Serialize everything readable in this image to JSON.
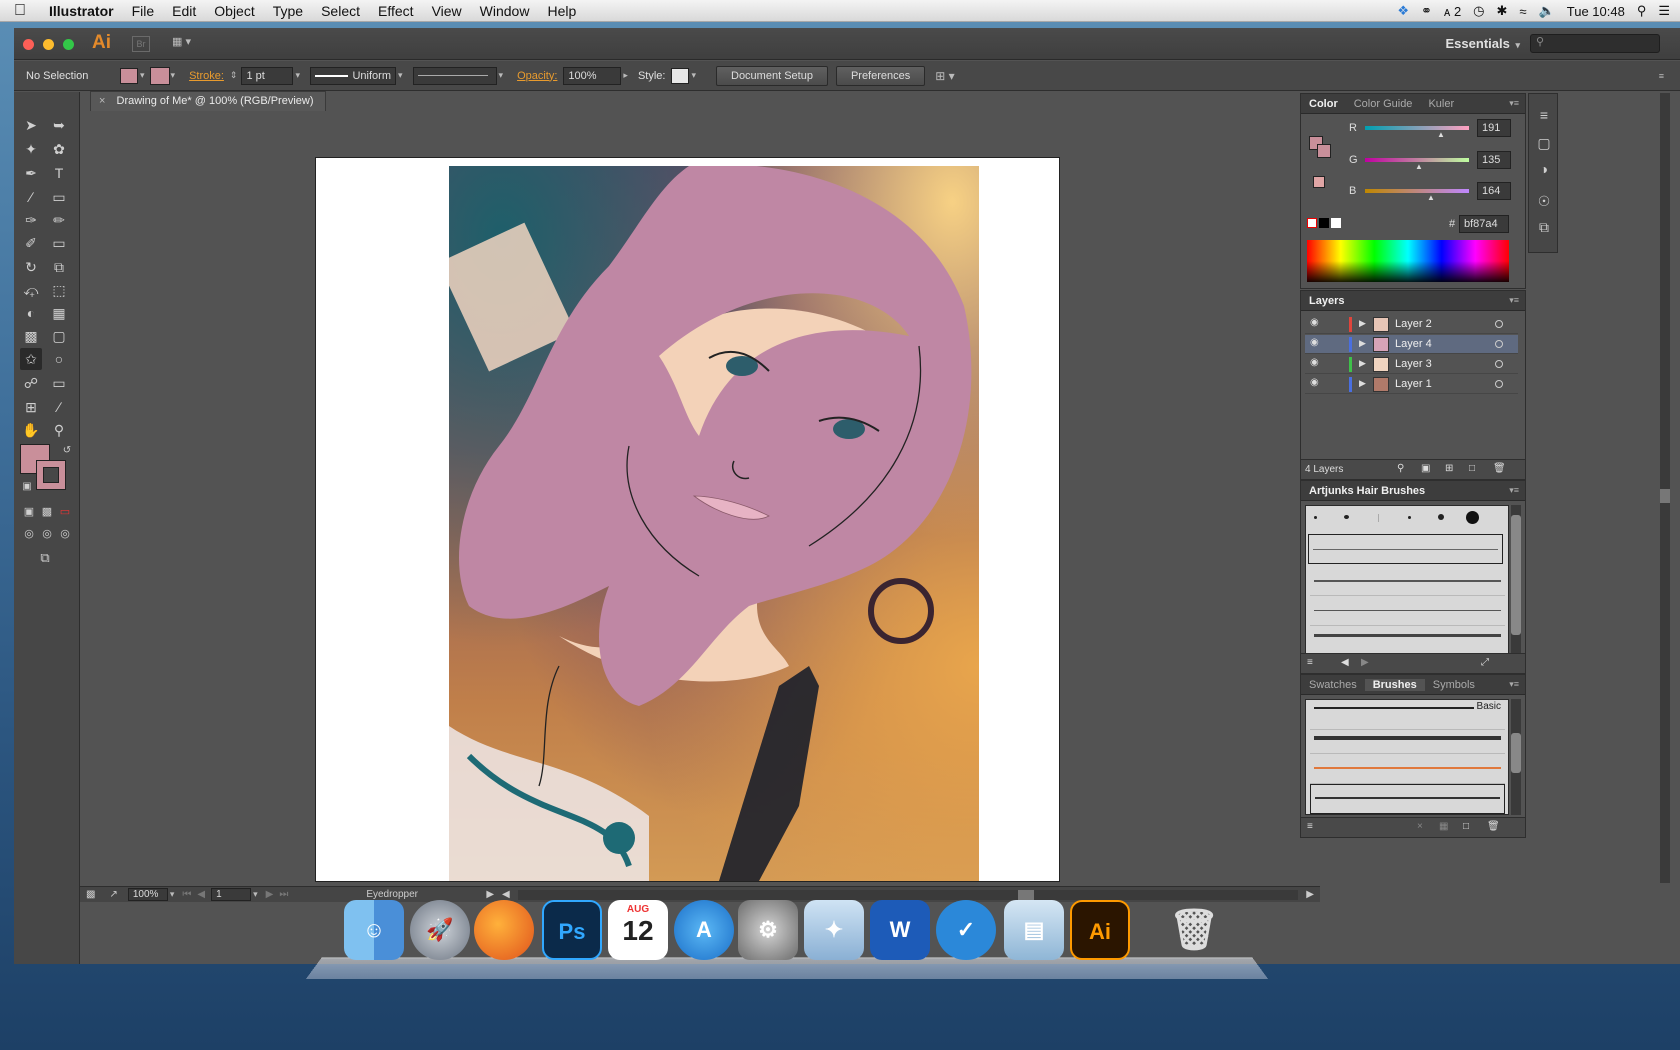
{
  "menubar": {
    "app_name": "Illustrator",
    "items": [
      "File",
      "Edit",
      "Object",
      "Type",
      "Select",
      "Effect",
      "View",
      "Window",
      "Help"
    ],
    "status_adobe": "2",
    "clock": "Tue 10:48"
  },
  "titlebar": {
    "app_mark": "Ai",
    "bridge_mark": "Br",
    "workspace": "Essentials",
    "search_placeholder": ""
  },
  "control": {
    "selection": "No Selection",
    "stroke_label": "Stroke:",
    "stroke_weight": "1 pt",
    "profile": "Uniform",
    "opacity_label": "Opacity:",
    "opacity_value": "100%",
    "style_label": "Style:",
    "document_setup": "Document Setup",
    "preferences": "Preferences",
    "fill_color": "#bf87a4",
    "stroke_color": "#bf87a4"
  },
  "document": {
    "tab_title": "Drawing of Me* @ 100% (RGB/Preview)"
  },
  "statusbar": {
    "zoom": "100%",
    "page": "1",
    "tool": "Eyedropper"
  },
  "color_panel": {
    "tabs": [
      "Color",
      "Color Guide",
      "Kuler"
    ],
    "r_label": "R",
    "r_value": "191",
    "r_fraction": 0.749,
    "g_label": "G",
    "g_value": "135",
    "g_fraction": 0.529,
    "b_label": "B",
    "b_value": "164",
    "b_fraction": 0.643,
    "hash": "#",
    "hex": "bf87a4"
  },
  "layers_panel": {
    "title": "Layers",
    "rows": [
      {
        "name": "Layer 2",
        "color": "#e0453c"
      },
      {
        "name": "Layer 4",
        "color": "#4a6fe0"
      },
      {
        "name": "Layer 3",
        "color": "#3fc04a"
      },
      {
        "name": "Layer 1",
        "color": "#4a6fe0"
      }
    ],
    "count": "4 Layers"
  },
  "hair_brushes": {
    "title": "Artjunks Hair Brushes"
  },
  "brushes_panel": {
    "tabs": [
      "Swatches",
      "Brushes",
      "Symbols"
    ],
    "basic_label": "Basic"
  },
  "dock": {
    "apps": [
      "Finder",
      "Launchpad",
      "Firefox",
      "Photoshop",
      "Calendar",
      "App Store",
      "System Preferences",
      "Preview",
      "Word",
      "Wunderlist",
      "Archive Utility",
      "Illustrator",
      "Trash"
    ],
    "calendar_month": "AUG",
    "calendar_day": "12",
    "ps_label": "Ps",
    "ai_label": "Ai",
    "word_label": "W"
  }
}
